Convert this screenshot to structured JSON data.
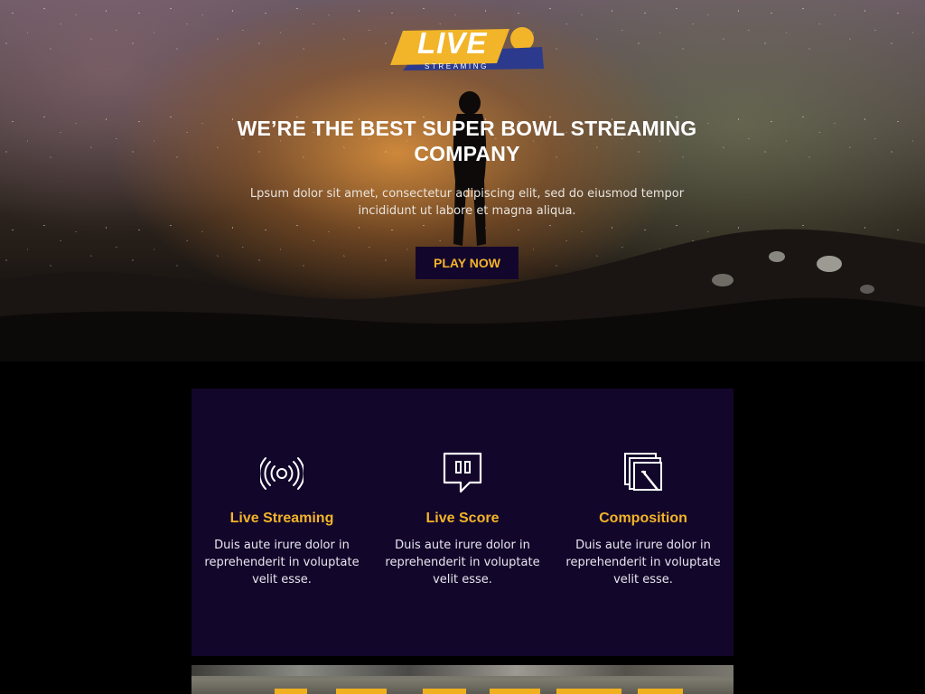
{
  "logo": {
    "word": "LIVE",
    "subword": "STREAMING",
    "colors": {
      "yellow": "#f2b428",
      "navy": "#2b3a8c",
      "white": "#ffffff"
    }
  },
  "hero": {
    "title": "WE’RE THE BEST SUPER BOWL STREAMING COMPANY",
    "subtitle": "Lpsum dolor sit amet, consectetur adipiscing elit, sed do eiusmod tempor incididunt ut labore et  magna aliqua.",
    "cta_label": "PLAY NOW"
  },
  "features": [
    {
      "icon": "broadcast-icon",
      "title": "Live Streaming",
      "text": "Duis aute irure dolor in reprehenderit in voluptate velit esse."
    },
    {
      "icon": "twitch-icon",
      "title": "Live Score",
      "text": "Duis aute irure dolor in reprehenderit in voluptate velit esse."
    },
    {
      "icon": "compose-icon",
      "title": "Composition",
      "text": "Duis aute irure dolor in reprehenderit in voluptate velit esse."
    }
  ],
  "colors": {
    "accent": "#f2b428",
    "panel": "#13062b",
    "background": "#000000",
    "text_light": "#e8e6ee"
  }
}
